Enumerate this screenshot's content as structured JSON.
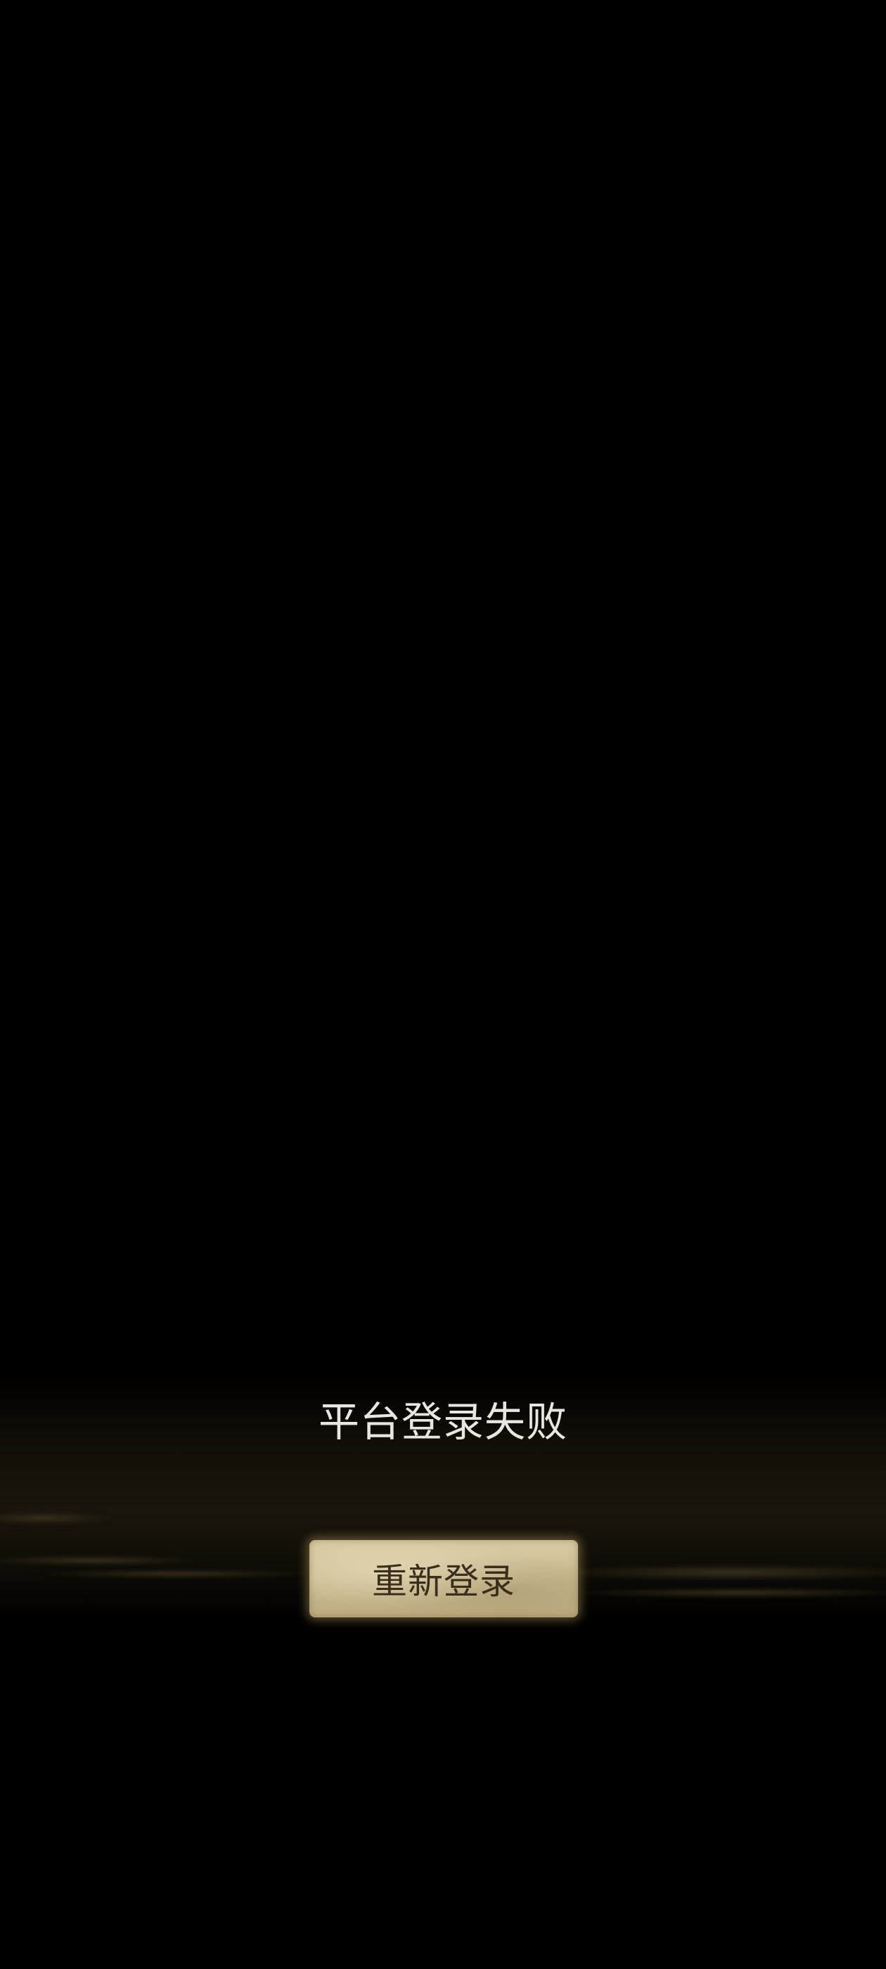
{
  "dialog": {
    "message": "平台登录失败",
    "relogin_button_label": "重新登录"
  },
  "colors": {
    "background": "#000000",
    "message_text": "#e8e6e0",
    "button_parchment": "#cbbd94",
    "button_text": "#3a2f1c"
  }
}
